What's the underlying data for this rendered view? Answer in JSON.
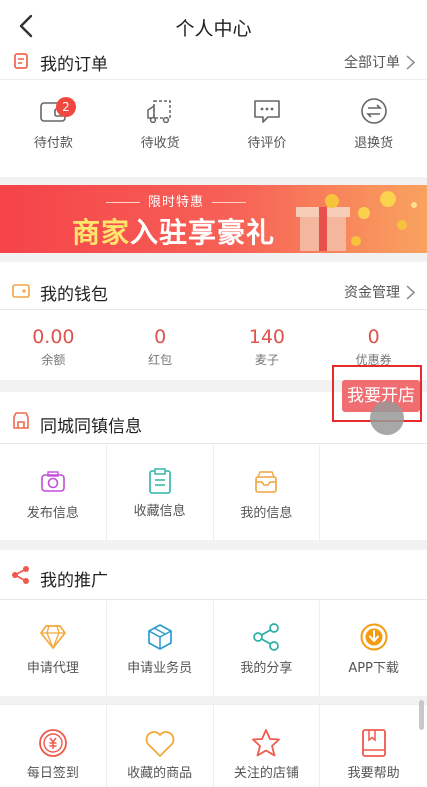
{
  "header": {
    "title": "个人中心"
  },
  "orders": {
    "title": "我的订单",
    "more": "全部订单",
    "items": [
      {
        "label": "待付款",
        "icon": "wallet-icon",
        "badge": "2"
      },
      {
        "label": "待收货",
        "icon": "truck-icon"
      },
      {
        "label": "待评价",
        "icon": "comment-icon"
      },
      {
        "label": "退换货",
        "icon": "exchange-icon"
      }
    ]
  },
  "banner": {
    "tag": "限时特惠",
    "text_highlight": "商家",
    "text_rest": "入驻享豪礼"
  },
  "wallet": {
    "title": "我的钱包",
    "more": "资金管理",
    "items": [
      {
        "value": "0.00",
        "label": "余额"
      },
      {
        "value": "0",
        "label": "红包"
      },
      {
        "value": "140",
        "label": "麦子"
      },
      {
        "value": "0",
        "label": "优惠券"
      }
    ]
  },
  "float_button": {
    "label": "我要开店"
  },
  "local_info": {
    "title": "同城同镇信息",
    "items": [
      {
        "label": "发布信息",
        "icon": "camera-icon",
        "color": "#c04fd8"
      },
      {
        "label": "收藏信息",
        "icon": "clipboard-icon",
        "color": "#2bb3a8"
      },
      {
        "label": "我的信息",
        "icon": "inbox-icon",
        "color": "#f0a442"
      }
    ]
  },
  "promotion": {
    "title": "我的推广",
    "items": [
      {
        "label": "申请代理",
        "icon": "diamond-icon",
        "color": "#f2a93b"
      },
      {
        "label": "申请业务员",
        "icon": "cube-icon",
        "color": "#2b9ccf"
      },
      {
        "label": "我的分享",
        "icon": "share-icon",
        "color": "#24b1a4"
      },
      {
        "label": "APP下载",
        "icon": "download-icon",
        "color": "#f39c12"
      }
    ]
  },
  "services": {
    "items": [
      {
        "label": "每日签到",
        "icon": "coin-icon",
        "color": "#ee5b4c"
      },
      {
        "label": "收藏的商品",
        "icon": "heart-icon",
        "color": "#f2a93b"
      },
      {
        "label": "关注的店铺",
        "icon": "star-icon",
        "color": "#ee5b4c"
      },
      {
        "label": "我要帮助",
        "icon": "help-book-icon",
        "color": "#ee5b4c"
      }
    ]
  },
  "colors": {
    "accent": "#e0524c",
    "float_border": "#e52b2b"
  }
}
